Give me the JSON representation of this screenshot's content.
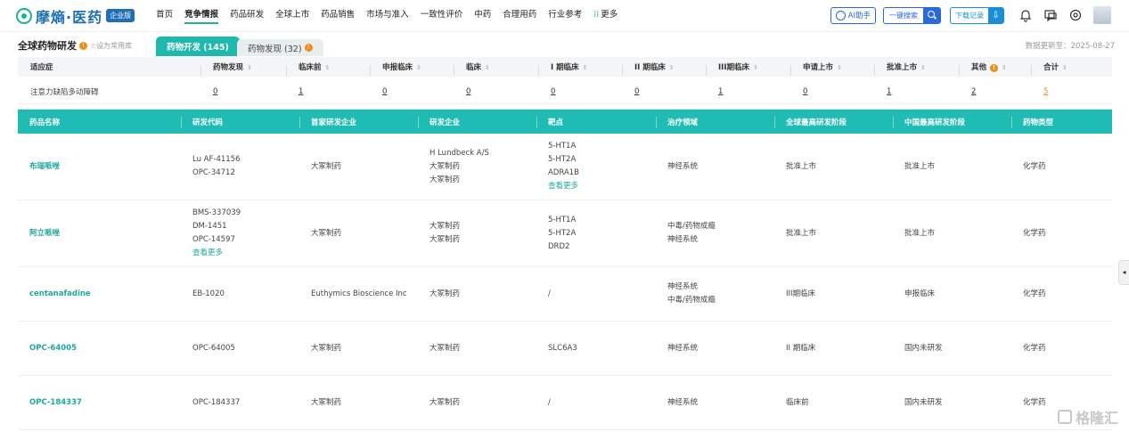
{
  "brand": {
    "name": "摩熵·医药",
    "badge": "企业版"
  },
  "nav": [
    "首页",
    "竞争情报",
    "药品研发",
    "全球上市",
    "药品销售",
    "市场与准入",
    "一致性评价",
    "中药",
    "合理用药",
    "行业参考",
    "更多"
  ],
  "nav_active_index": 1,
  "toolbar": {
    "ai": "AI助手",
    "search": "一键搜索",
    "download": "下载记录"
  },
  "subheader": {
    "title": "全球药物研发",
    "set_common": "设为常用库",
    "tab_active": "药物开发 (145)",
    "tab_inactive": "药物发现 (32)",
    "update_time": "数据更新至：2025-08-27"
  },
  "summary": {
    "headers": [
      "适应症",
      "药物发现",
      "临床前",
      "申报临床",
      "临床",
      "I 期临床",
      "II 期临床",
      "III期临床",
      "申请上市",
      "批准上市",
      "其他",
      "合计"
    ],
    "row": [
      "注意力缺陷多动障碍",
      "0",
      "1",
      "0",
      "0",
      "0",
      "0",
      "1",
      "0",
      "1",
      "2",
      "5"
    ]
  },
  "main": {
    "headers": [
      "药品名称",
      "研发代码",
      "首家研发企业",
      "研发企业",
      "靶点",
      "治疗领域",
      "全球最高研发阶段",
      "中国最高研发阶段",
      "药物类型"
    ],
    "rows": [
      {
        "name": "布瑞哌唑",
        "codes": "Lu AF-41156\nOPC-34712",
        "first": "大冢制药",
        "companies": "H Lundbeck A/S\n大冢制药\n大冢制药",
        "targets": "5-HT1A\n5-HT2A\nADRA1B",
        "targets_more": "查看更多",
        "codes_more": "",
        "area": "神经系统",
        "global": "批准上市",
        "china": "批准上市",
        "type": "化学药"
      },
      {
        "name": "阿立哌唑",
        "codes": "BMS-337039\nDM-1451\nOPC-14597",
        "codes_more": "查看更多",
        "first": "大冢制药",
        "companies": "大冢制药\n大冢制药",
        "targets": "5-HT1A\n5-HT2A\nDRD2",
        "targets_more": "",
        "area": "中毒/药物成瘾\n神经系统",
        "global": "批准上市",
        "china": "批准上市",
        "type": "化学药"
      },
      {
        "name": "centanafadine",
        "codes": "EB-1020",
        "codes_more": "",
        "first": "Euthymics Bioscience Inc",
        "companies": "大冢制药",
        "targets": "/",
        "targets_more": "",
        "area": "神经系统\n中毒/药物成瘾",
        "global": "III期临床",
        "china": "申报临床",
        "type": "化学药"
      },
      {
        "name": "OPC-64005",
        "codes": "OPC-64005",
        "codes_more": "",
        "first": "大冢制药",
        "companies": "大冢制药",
        "targets": "SLC6A3",
        "targets_more": "",
        "area": "神经系统",
        "global": "II 期临床",
        "china": "国内未研发",
        "type": "化学药"
      },
      {
        "name": "OPC-184337",
        "codes": "OPC-184337",
        "codes_more": "",
        "first": "大冢制药",
        "companies": "大冢制药",
        "targets": "/",
        "targets_more": "",
        "area": "神经系统",
        "global": "临床前",
        "china": "国内未研发",
        "type": "化学药"
      }
    ]
  },
  "watermark": "格隆汇",
  "colors": {
    "accent": "#1fbcb3",
    "brand": "#1e6fb3",
    "warn": "#f08c18"
  }
}
